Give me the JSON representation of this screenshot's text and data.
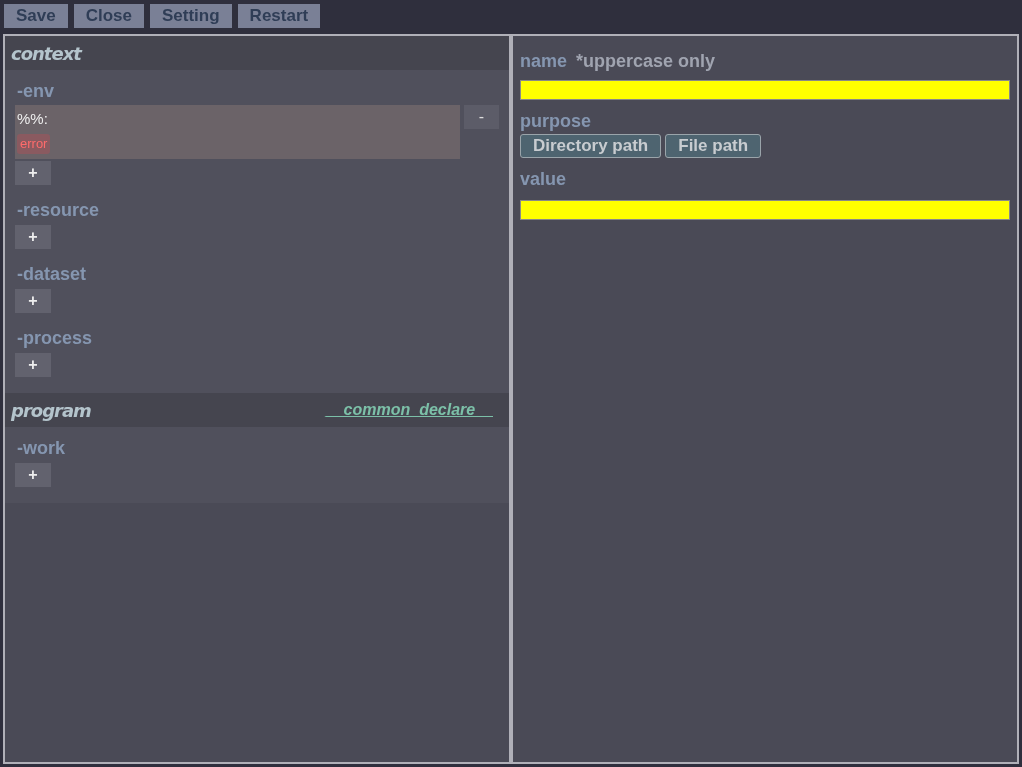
{
  "toolbar": [
    "Save",
    "Close",
    "Setting",
    "Restart"
  ],
  "sections": [
    {
      "title": "context",
      "groups": [
        {
          "label": "-env",
          "entries": [
            {
              "text": "%%:",
              "error": "error",
              "remove": "-"
            }
          ],
          "add": "+"
        },
        {
          "label": "-resource",
          "add": "+"
        },
        {
          "label": "-dataset",
          "add": "+"
        },
        {
          "label": "-process",
          "add": "+"
        }
      ]
    },
    {
      "title": "program",
      "link": "__common_declare__",
      "groups": [
        {
          "label": "-work",
          "add": "+"
        }
      ]
    }
  ],
  "detail": {
    "name_label": "name",
    "name_hint": "*uppercase only",
    "purpose_label": "purpose",
    "purpose_options": [
      "Directory path",
      "File path"
    ],
    "value_label": "value"
  }
}
